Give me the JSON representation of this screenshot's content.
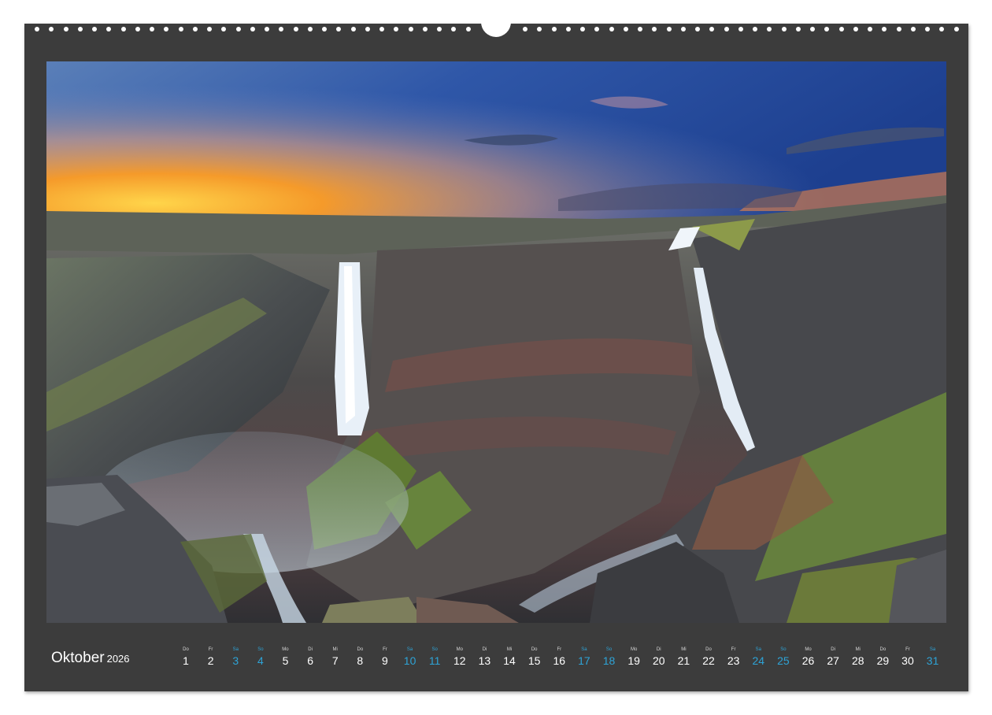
{
  "calendar": {
    "month": "Oktober",
    "year": "2026",
    "days": [
      {
        "dow": "Do",
        "num": "1",
        "weekend": false
      },
      {
        "dow": "Fr",
        "num": "2",
        "weekend": false
      },
      {
        "dow": "Sa",
        "num": "3",
        "weekend": true
      },
      {
        "dow": "So",
        "num": "4",
        "weekend": true
      },
      {
        "dow": "Mo",
        "num": "5",
        "weekend": false
      },
      {
        "dow": "Di",
        "num": "6",
        "weekend": false
      },
      {
        "dow": "Mi",
        "num": "7",
        "weekend": false
      },
      {
        "dow": "Do",
        "num": "8",
        "weekend": false
      },
      {
        "dow": "Fr",
        "num": "9",
        "weekend": false
      },
      {
        "dow": "Sa",
        "num": "10",
        "weekend": true
      },
      {
        "dow": "So",
        "num": "11",
        "weekend": true
      },
      {
        "dow": "Mo",
        "num": "12",
        "weekend": false
      },
      {
        "dow": "Di",
        "num": "13",
        "weekend": false
      },
      {
        "dow": "Mi",
        "num": "14",
        "weekend": false
      },
      {
        "dow": "Do",
        "num": "15",
        "weekend": false
      },
      {
        "dow": "Fr",
        "num": "16",
        "weekend": false
      },
      {
        "dow": "Sa",
        "num": "17",
        "weekend": true
      },
      {
        "dow": "So",
        "num": "18",
        "weekend": true
      },
      {
        "dow": "Mo",
        "num": "19",
        "weekend": false
      },
      {
        "dow": "Di",
        "num": "20",
        "weekend": false
      },
      {
        "dow": "Mi",
        "num": "21",
        "weekend": false
      },
      {
        "dow": "Do",
        "num": "22",
        "weekend": false
      },
      {
        "dow": "Fr",
        "num": "23",
        "weekend": false
      },
      {
        "dow": "Sa",
        "num": "24",
        "weekend": true
      },
      {
        "dow": "So",
        "num": "25",
        "weekend": true
      },
      {
        "dow": "Mo",
        "num": "26",
        "weekend": false
      },
      {
        "dow": "Di",
        "num": "27",
        "weekend": false
      },
      {
        "dow": "Mi",
        "num": "28",
        "weekend": false
      },
      {
        "dow": "Do",
        "num": "29",
        "weekend": false
      },
      {
        "dow": "Fr",
        "num": "30",
        "weekend": false
      },
      {
        "dow": "Sa",
        "num": "31",
        "weekend": true
      }
    ]
  },
  "colors": {
    "frame": "#3c3c3c",
    "weekday_text": "#ffffff",
    "weekend_text": "#2ea3d6"
  }
}
